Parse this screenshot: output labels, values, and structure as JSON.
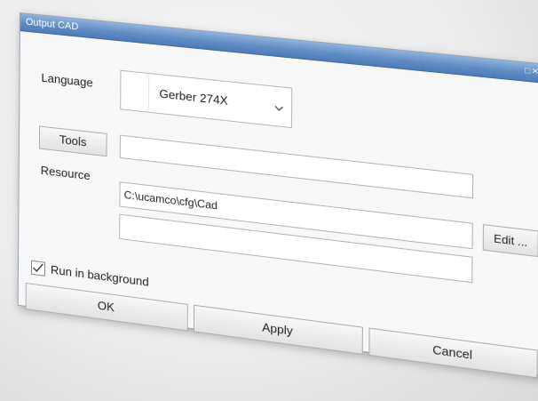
{
  "window": {
    "title": "Output CAD",
    "title_controls": "□✕"
  },
  "language": {
    "label": "Language",
    "value": "Gerber 274X"
  },
  "tools": {
    "button_label": "Tools",
    "value": ""
  },
  "resource": {
    "label": "Resource",
    "value": "C:\\ucamco\\cfg\\Cad",
    "value2": "",
    "edit_label": "Edit ..."
  },
  "options": {
    "run_in_background_label": "Run in background",
    "run_in_background_checked": true
  },
  "actions": {
    "ok_label": "OK",
    "apply_label": "Apply",
    "cancel_label": "Cancel"
  },
  "colors": {
    "titlebar": "#5f8dc4",
    "dialog_bg": "#f7f7f7"
  }
}
